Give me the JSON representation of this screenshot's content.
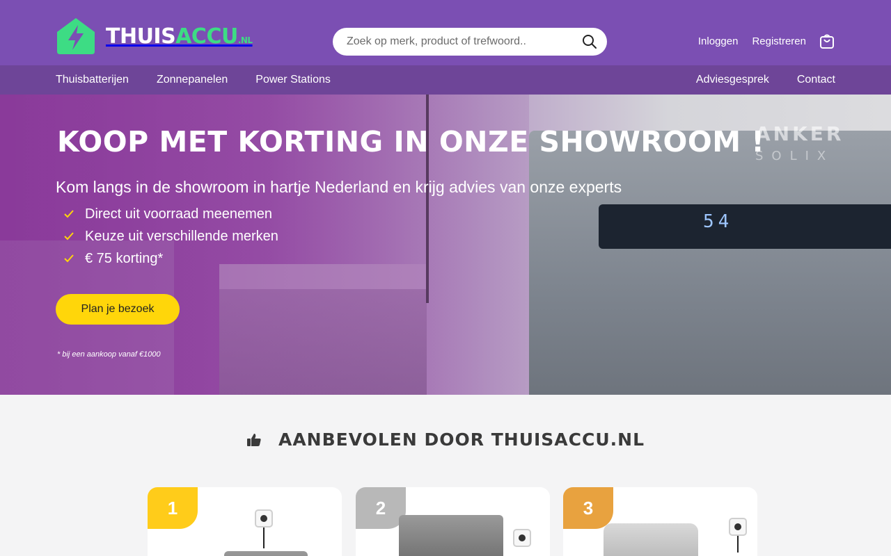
{
  "header": {
    "logo": {
      "name": "THUISACCU",
      "name_main": "THUIS",
      "name_accent": "ACCU",
      "tld": ".NL"
    },
    "search": {
      "placeholder": "Zoek op merk, product of trefwoord.."
    },
    "login_label": "Inloggen",
    "register_label": "Registreren"
  },
  "nav": {
    "left": [
      "Thuisbatterijen",
      "Zonnepanelen",
      "Power Stations"
    ],
    "right": [
      "Adviesgesprek",
      "Contact"
    ]
  },
  "hero": {
    "title": "KOOP MET KORTING IN ONZE SHOWROOM !",
    "subtitle": "Kom langs in de showroom in hartje Nederland en krijg advies van onze experts",
    "bullets": [
      "Direct uit voorraad meenemen",
      "Keuze uit verschillende merken",
      "€ 75 korting*"
    ],
    "cta_label": "Plan je bezoek",
    "disclaimer": "* bij een aankoop vanaf €1000",
    "device_brand": "ANKER",
    "device_brand_sub": "SOLIX",
    "device_readout": "54"
  },
  "recommended": {
    "title": "AANBEVOLEN DOOR THUISACCU.NL",
    "ranks": [
      "1",
      "2",
      "3"
    ]
  },
  "colors": {
    "header_bg": "#7b4fb3",
    "nav_bg": "#6e4598",
    "accent_green": "#3ddc84",
    "cta_yellow": "#ffd60a",
    "rank_gold": "#ffcc1a",
    "rank_silver": "#b8b8b8",
    "rank_bronze": "#e8a23f"
  },
  "icons": [
    "lightning-house-icon",
    "search-icon",
    "cart-icon",
    "check-icon",
    "thumbs-up-icon"
  ]
}
